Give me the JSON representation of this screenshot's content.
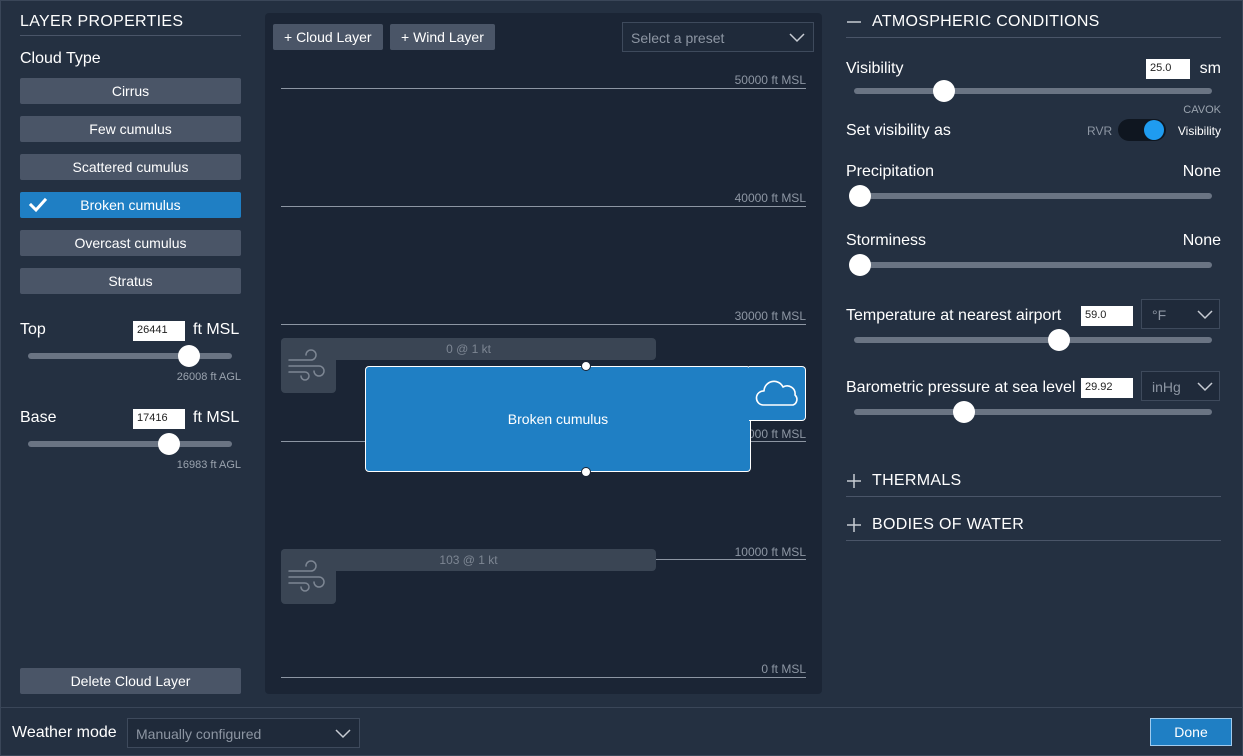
{
  "layer_properties": {
    "title": "LAYER PROPERTIES",
    "cloud_type_label": "Cloud Type",
    "cloud_types": [
      {
        "label": "Cirrus"
      },
      {
        "label": "Few cumulus"
      },
      {
        "label": "Scattered cumulus"
      },
      {
        "label": "Broken cumulus",
        "selected": true
      },
      {
        "label": "Overcast cumulus"
      },
      {
        "label": "Stratus"
      }
    ],
    "top": {
      "label": "Top",
      "value": "26441",
      "unit": "ft MSL",
      "agl": "26008 ft AGL"
    },
    "base": {
      "label": "Base",
      "value": "17416",
      "unit": "ft MSL",
      "agl": "16983 ft AGL"
    },
    "delete_label": "Delete Cloud Layer"
  },
  "layers_view": {
    "add_cloud_label": "+ Cloud Layer",
    "add_wind_label": "+ Wind Layer",
    "preset_placeholder": "Select a preset",
    "altitudes": [
      {
        "label": "50000 ft MSL"
      },
      {
        "label": "40000 ft MSL"
      },
      {
        "label": "30000 ft MSL"
      },
      {
        "label": "000 ft MSL"
      },
      {
        "label": "10000 ft MSL"
      },
      {
        "label": "0 ft MSL"
      }
    ],
    "wind_layers": [
      {
        "label": "0 @ 1 kt"
      },
      {
        "label": "103 @ 1 kt"
      }
    ],
    "cloud_layer_label": "Broken cumulus"
  },
  "atmospheric": {
    "title": "ATMOSPHERIC CONDITIONS",
    "visibility": {
      "label": "Visibility",
      "value": "25.0",
      "unit": "sm",
      "note": "CAVOK"
    },
    "set_visibility": {
      "label": "Set visibility as",
      "option_left": "RVR",
      "option_right": "Visibility"
    },
    "precipitation": {
      "label": "Precipitation",
      "value": "None"
    },
    "storminess": {
      "label": "Storminess",
      "value": "None"
    },
    "temperature": {
      "label": "Temperature at nearest airport",
      "value": "59.0",
      "unit": "°F"
    },
    "pressure": {
      "label": "Barometric pressure at sea level",
      "value": "29.92",
      "unit": "inHg"
    }
  },
  "sections": {
    "thermals": "THERMALS",
    "bodies_of_water": "BODIES OF WATER"
  },
  "footer": {
    "weather_mode_label": "Weather mode",
    "weather_mode_value": "Manually configured",
    "done_label": "Done"
  },
  "colors": {
    "accent": "#1f7fc4",
    "toggle_on": "#1f9cf0",
    "background": "#243041"
  }
}
